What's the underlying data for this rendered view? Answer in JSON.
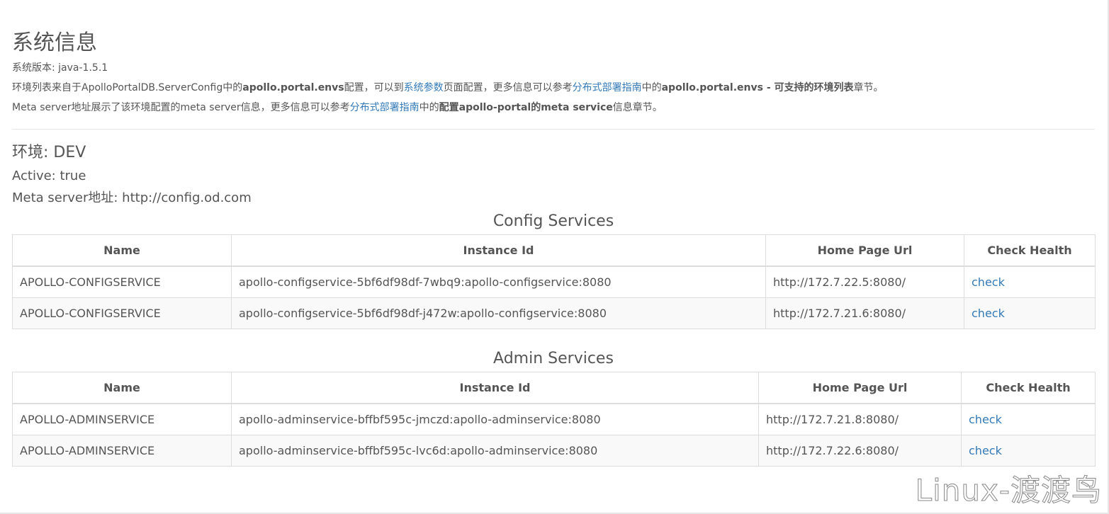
{
  "header": {
    "title": "系统信息",
    "version_label": "系统版本: java-1.5.1",
    "env_note": {
      "t1": "环境列表来自于ApolloPortalDB.ServerConfig中的",
      "b1": "apollo.portal.envs",
      "t2": "配置，可以到",
      "link1": "系统参数",
      "t3": "页面配置，更多信息可以参考",
      "link2": "分布式部署指南",
      "t4": "中的",
      "b2": "apollo.portal.envs - 可支持的环境列表",
      "t5": "章节。"
    },
    "meta_note": {
      "t1": "Meta server地址展示了该环境配置的meta server信息，更多信息可以参考",
      "link1": "分布式部署指南",
      "t2": "中的",
      "b1": "配置apollo-portal的meta service",
      "t3": "信息章节。"
    }
  },
  "environment": {
    "title": "环境: DEV",
    "active": "Active: true",
    "meta_server": "Meta server地址: http://config.od.com"
  },
  "config_services": {
    "title": "Config Services",
    "columns": [
      "Name",
      "Instance Id",
      "Home Page Url",
      "Check Health"
    ],
    "rows": [
      {
        "name": "APOLLO-CONFIGSERVICE",
        "instance_id": "apollo-configservice-5bf6df98df-7wbq9:apollo-configservice:8080",
        "home_page_url": "http://172.7.22.5:8080/",
        "check": "check"
      },
      {
        "name": "APOLLO-CONFIGSERVICE",
        "instance_id": "apollo-configservice-5bf6df98df-j472w:apollo-configservice:8080",
        "home_page_url": "http://172.7.21.6:8080/",
        "check": "check"
      }
    ]
  },
  "admin_services": {
    "title": "Admin Services",
    "columns": [
      "Name",
      "Instance Id",
      "Home Page Url",
      "Check Health"
    ],
    "rows": [
      {
        "name": "APOLLO-ADMINSERVICE",
        "instance_id": "apollo-adminservice-bffbf595c-jmczd:apollo-adminservice:8080",
        "home_page_url": "http://172.7.21.8:8080/",
        "check": "check"
      },
      {
        "name": "APOLLO-ADMINSERVICE",
        "instance_id": "apollo-adminservice-bffbf595c-lvc6d:apollo-adminservice:8080",
        "home_page_url": "http://172.7.22.6:8080/",
        "check": "check"
      }
    ]
  },
  "watermark": "Linux-渡渡鸟",
  "colors": {
    "link": "#337ab7",
    "text": "#555555",
    "border": "#dddddd"
  }
}
